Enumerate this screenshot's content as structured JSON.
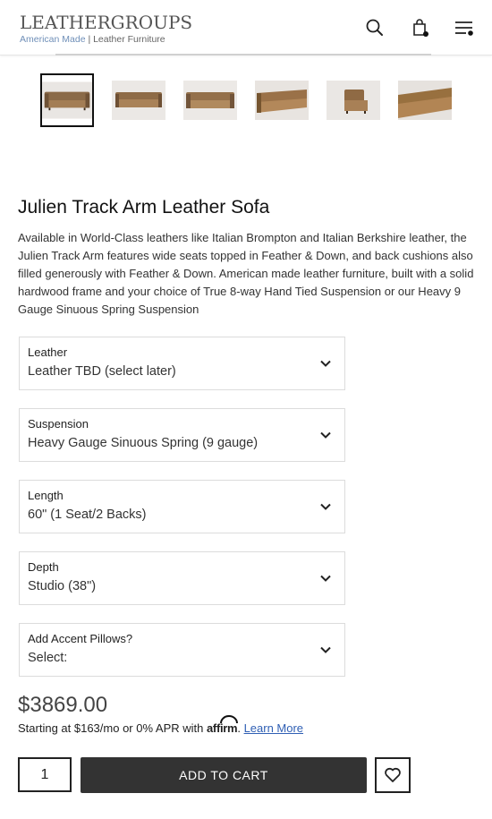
{
  "header": {
    "logo_main": "LEATHERGROUPS",
    "logo_sub_accent": "American Made",
    "logo_sub_rest": " | Leather Furniture",
    "icons": [
      "search-icon",
      "shopping-bag-icon",
      "menu-icon"
    ]
  },
  "gallery": {
    "thumbnails": [
      {
        "name": "thumbnail-1",
        "selected": true
      },
      {
        "name": "thumbnail-2",
        "selected": false
      },
      {
        "name": "thumbnail-3",
        "selected": false
      },
      {
        "name": "thumbnail-4",
        "selected": false
      },
      {
        "name": "thumbnail-5",
        "selected": false
      },
      {
        "name": "thumbnail-6",
        "selected": false
      }
    ]
  },
  "product": {
    "title": "Julien Track Arm Leather Sofa",
    "description": "Available in World-Class leathers like Italian Brompton and Italian Berkshire leather, the Julien Track Arm features wide seats topped in Feather & Down, and back cushions also filled generously with Feather & Down. American made leather furniture, built with a solid hardwood frame and your choice of True 8-way Hand Tied Suspension or our Heavy 9 Gauge Sinuous Spring Suspension"
  },
  "options": [
    {
      "label": "Leather",
      "value": "Leather TBD (select later)"
    },
    {
      "label": "Suspension",
      "value": "Heavy Gauge Sinuous Spring (9 gauge)"
    },
    {
      "label": "Length",
      "value": "60\" (1 Seat/2 Backs)"
    },
    {
      "label": "Depth",
      "value": "Studio (38\")"
    },
    {
      "label": "Add Accent Pillows?",
      "value": "Select:"
    }
  ],
  "pricing": {
    "price": "$3869.00",
    "finance_text": "Starting at $163/mo or 0% APR with ",
    "affirm_brand": "affirm",
    "finance_end": ". ",
    "learn_more": "Learn More"
  },
  "purchase": {
    "quantity": "1",
    "add_to_cart": "ADD TO CART",
    "wishlist_icon": "heart-icon"
  },
  "colors": {
    "button_dark": "#333333",
    "link_blue": "#2f5fb4",
    "logo_accent": "#6f8fb8"
  }
}
